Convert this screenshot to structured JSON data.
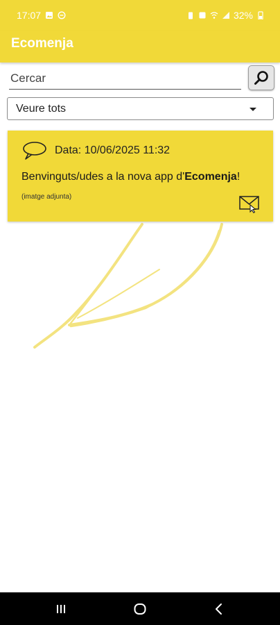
{
  "status": {
    "time": "17:07",
    "battery": "32%"
  },
  "app": {
    "title": "Ecomenja"
  },
  "search": {
    "placeholder": "Cercar"
  },
  "filter": {
    "selected": "Veure tots"
  },
  "messages": [
    {
      "date": "Data: 10/06/2025 11:32",
      "text_prefix": "Benvinguts/udes a la nova app d'",
      "text_bold": "Ecomenja",
      "text_suffix": "!",
      "attachment": "(imatge adjunta)"
    }
  ],
  "colors": {
    "accent": "#f1d938",
    "nav": "#000000"
  },
  "icons": [
    "search-icon",
    "chevron-down-icon",
    "speech-bubble-icon",
    "mail-icon",
    "recents-icon",
    "home-icon",
    "back-icon"
  ]
}
